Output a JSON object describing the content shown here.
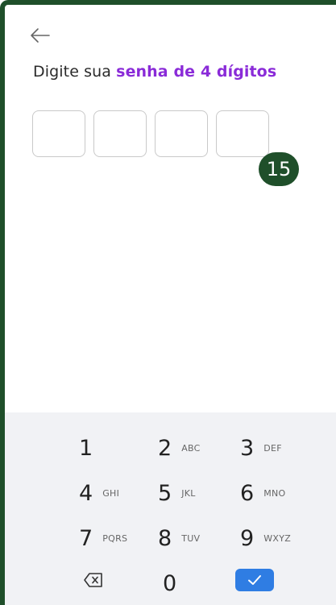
{
  "header": {
    "back_icon": "arrow-left-icon"
  },
  "prompt": {
    "prefix": "Digite sua ",
    "highlight": "senha de 4 dígitos",
    "highlight_color": "#8a2bd8"
  },
  "pin": {
    "length": 4,
    "filled": 0
  },
  "annotation": {
    "badge": "15",
    "color": "#1f4f2a"
  },
  "keyboard": {
    "keys": [
      {
        "digit": "1",
        "letters": ""
      },
      {
        "digit": "2",
        "letters": "ABC"
      },
      {
        "digit": "3",
        "letters": "DEF"
      },
      {
        "digit": "4",
        "letters": "GHI"
      },
      {
        "digit": "5",
        "letters": "JKL"
      },
      {
        "digit": "6",
        "letters": "MNO"
      },
      {
        "digit": "7",
        "letters": "PQRS"
      },
      {
        "digit": "8",
        "letters": "TUV"
      },
      {
        "digit": "9",
        "letters": "WXYZ"
      },
      {
        "digit": "0",
        "letters": ""
      }
    ],
    "delete_icon": "backspace-icon",
    "confirm_icon": "check-icon",
    "confirm_color": "#2f7de3"
  }
}
